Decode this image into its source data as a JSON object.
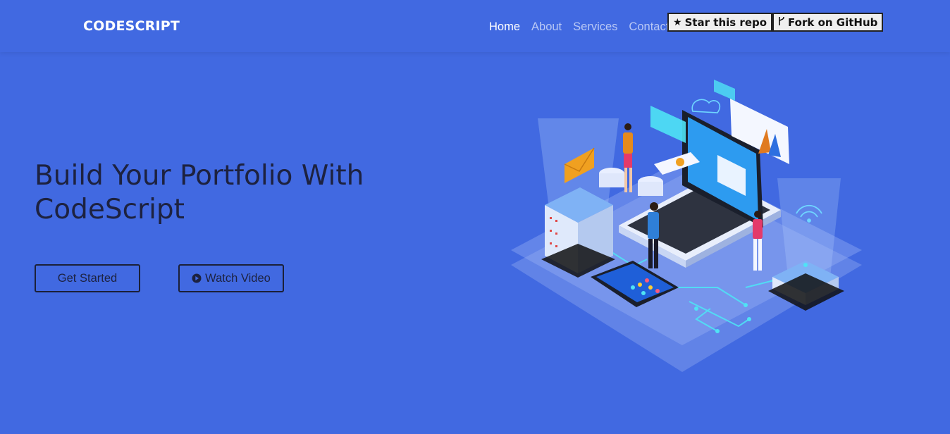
{
  "navbar": {
    "brand": "CODESCRIPT",
    "links": [
      {
        "label": "Home",
        "active": true
      },
      {
        "label": "About",
        "active": false
      },
      {
        "label": "Services",
        "active": false
      },
      {
        "label": "Contact",
        "active": false
      }
    ],
    "github": {
      "star_label": "Star this repo",
      "fork_label": "Fork on GitHub",
      "star_icon": "star-icon",
      "fork_icon": "fork-icon"
    }
  },
  "hero": {
    "title_line1": "Build Your Portfolio With",
    "title_line2": "CodeScript",
    "get_started_label": "Get Started",
    "watch_video_label": "Watch Video",
    "watch_icon": "play-circle-icon"
  },
  "colors": {
    "background": "#4169e1",
    "heading": "#1d2240",
    "nav_active": "#ffffff",
    "nav_inactive": "#b9c8f5"
  }
}
